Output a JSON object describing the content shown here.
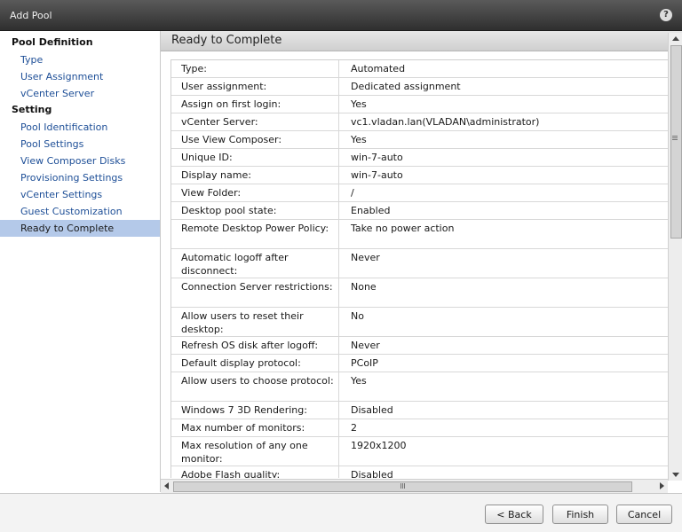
{
  "window": {
    "title": "Add Pool",
    "help_label": "?"
  },
  "sidebar": {
    "sections": [
      {
        "label": "Pool Definition",
        "items": [
          "Type",
          "User Assignment",
          "vCenter Server"
        ]
      },
      {
        "label": "Setting",
        "items": [
          "Pool Identification",
          "Pool Settings",
          "View Composer Disks",
          "Provisioning Settings",
          "vCenter Settings",
          "Guest Customization",
          "Ready to Complete"
        ]
      }
    ],
    "selected": "Ready to Complete"
  },
  "main": {
    "heading": "Ready to Complete",
    "rows": [
      {
        "key": "Type:",
        "value": "Automated"
      },
      {
        "key": "User assignment:",
        "value": "Dedicated assignment"
      },
      {
        "key": "Assign on first login:",
        "value": "Yes"
      },
      {
        "key": "vCenter Server:",
        "value": "vc1.vladan.lan(VLADAN\\administrator)"
      },
      {
        "key": "Use View Composer:",
        "value": "Yes"
      },
      {
        "key": "Unique ID:",
        "value": "win-7-auto"
      },
      {
        "key": "Display name:",
        "value": "win-7-auto"
      },
      {
        "key": "View Folder:",
        "value": "/"
      },
      {
        "key": "Desktop pool state:",
        "value": "Enabled"
      },
      {
        "key": "Remote Desktop Power Policy:",
        "value": "Take no power action"
      },
      {
        "key": "Automatic logoff after disconnect:",
        "value": "Never"
      },
      {
        "key": "Connection Server restrictions:",
        "value": "None"
      },
      {
        "key": "Allow users to reset their desktop:",
        "value": "No"
      },
      {
        "key": "Refresh OS disk after logoff:",
        "value": "Never"
      },
      {
        "key": "Default display protocol:",
        "value": "PCoIP"
      },
      {
        "key": "Allow users to choose protocol:",
        "value": "Yes"
      },
      {
        "key": "Windows 7 3D Rendering:",
        "value": "Disabled"
      },
      {
        "key": "Max number of monitors:",
        "value": "2"
      },
      {
        "key": "Max resolution of any one monitor:",
        "value": "1920x1200"
      },
      {
        "key": "Adobe Flash quality:",
        "value": "Disabled"
      }
    ]
  },
  "footer": {
    "back_label": "< Back",
    "finish_label": "Finish",
    "cancel_label": "Cancel"
  }
}
